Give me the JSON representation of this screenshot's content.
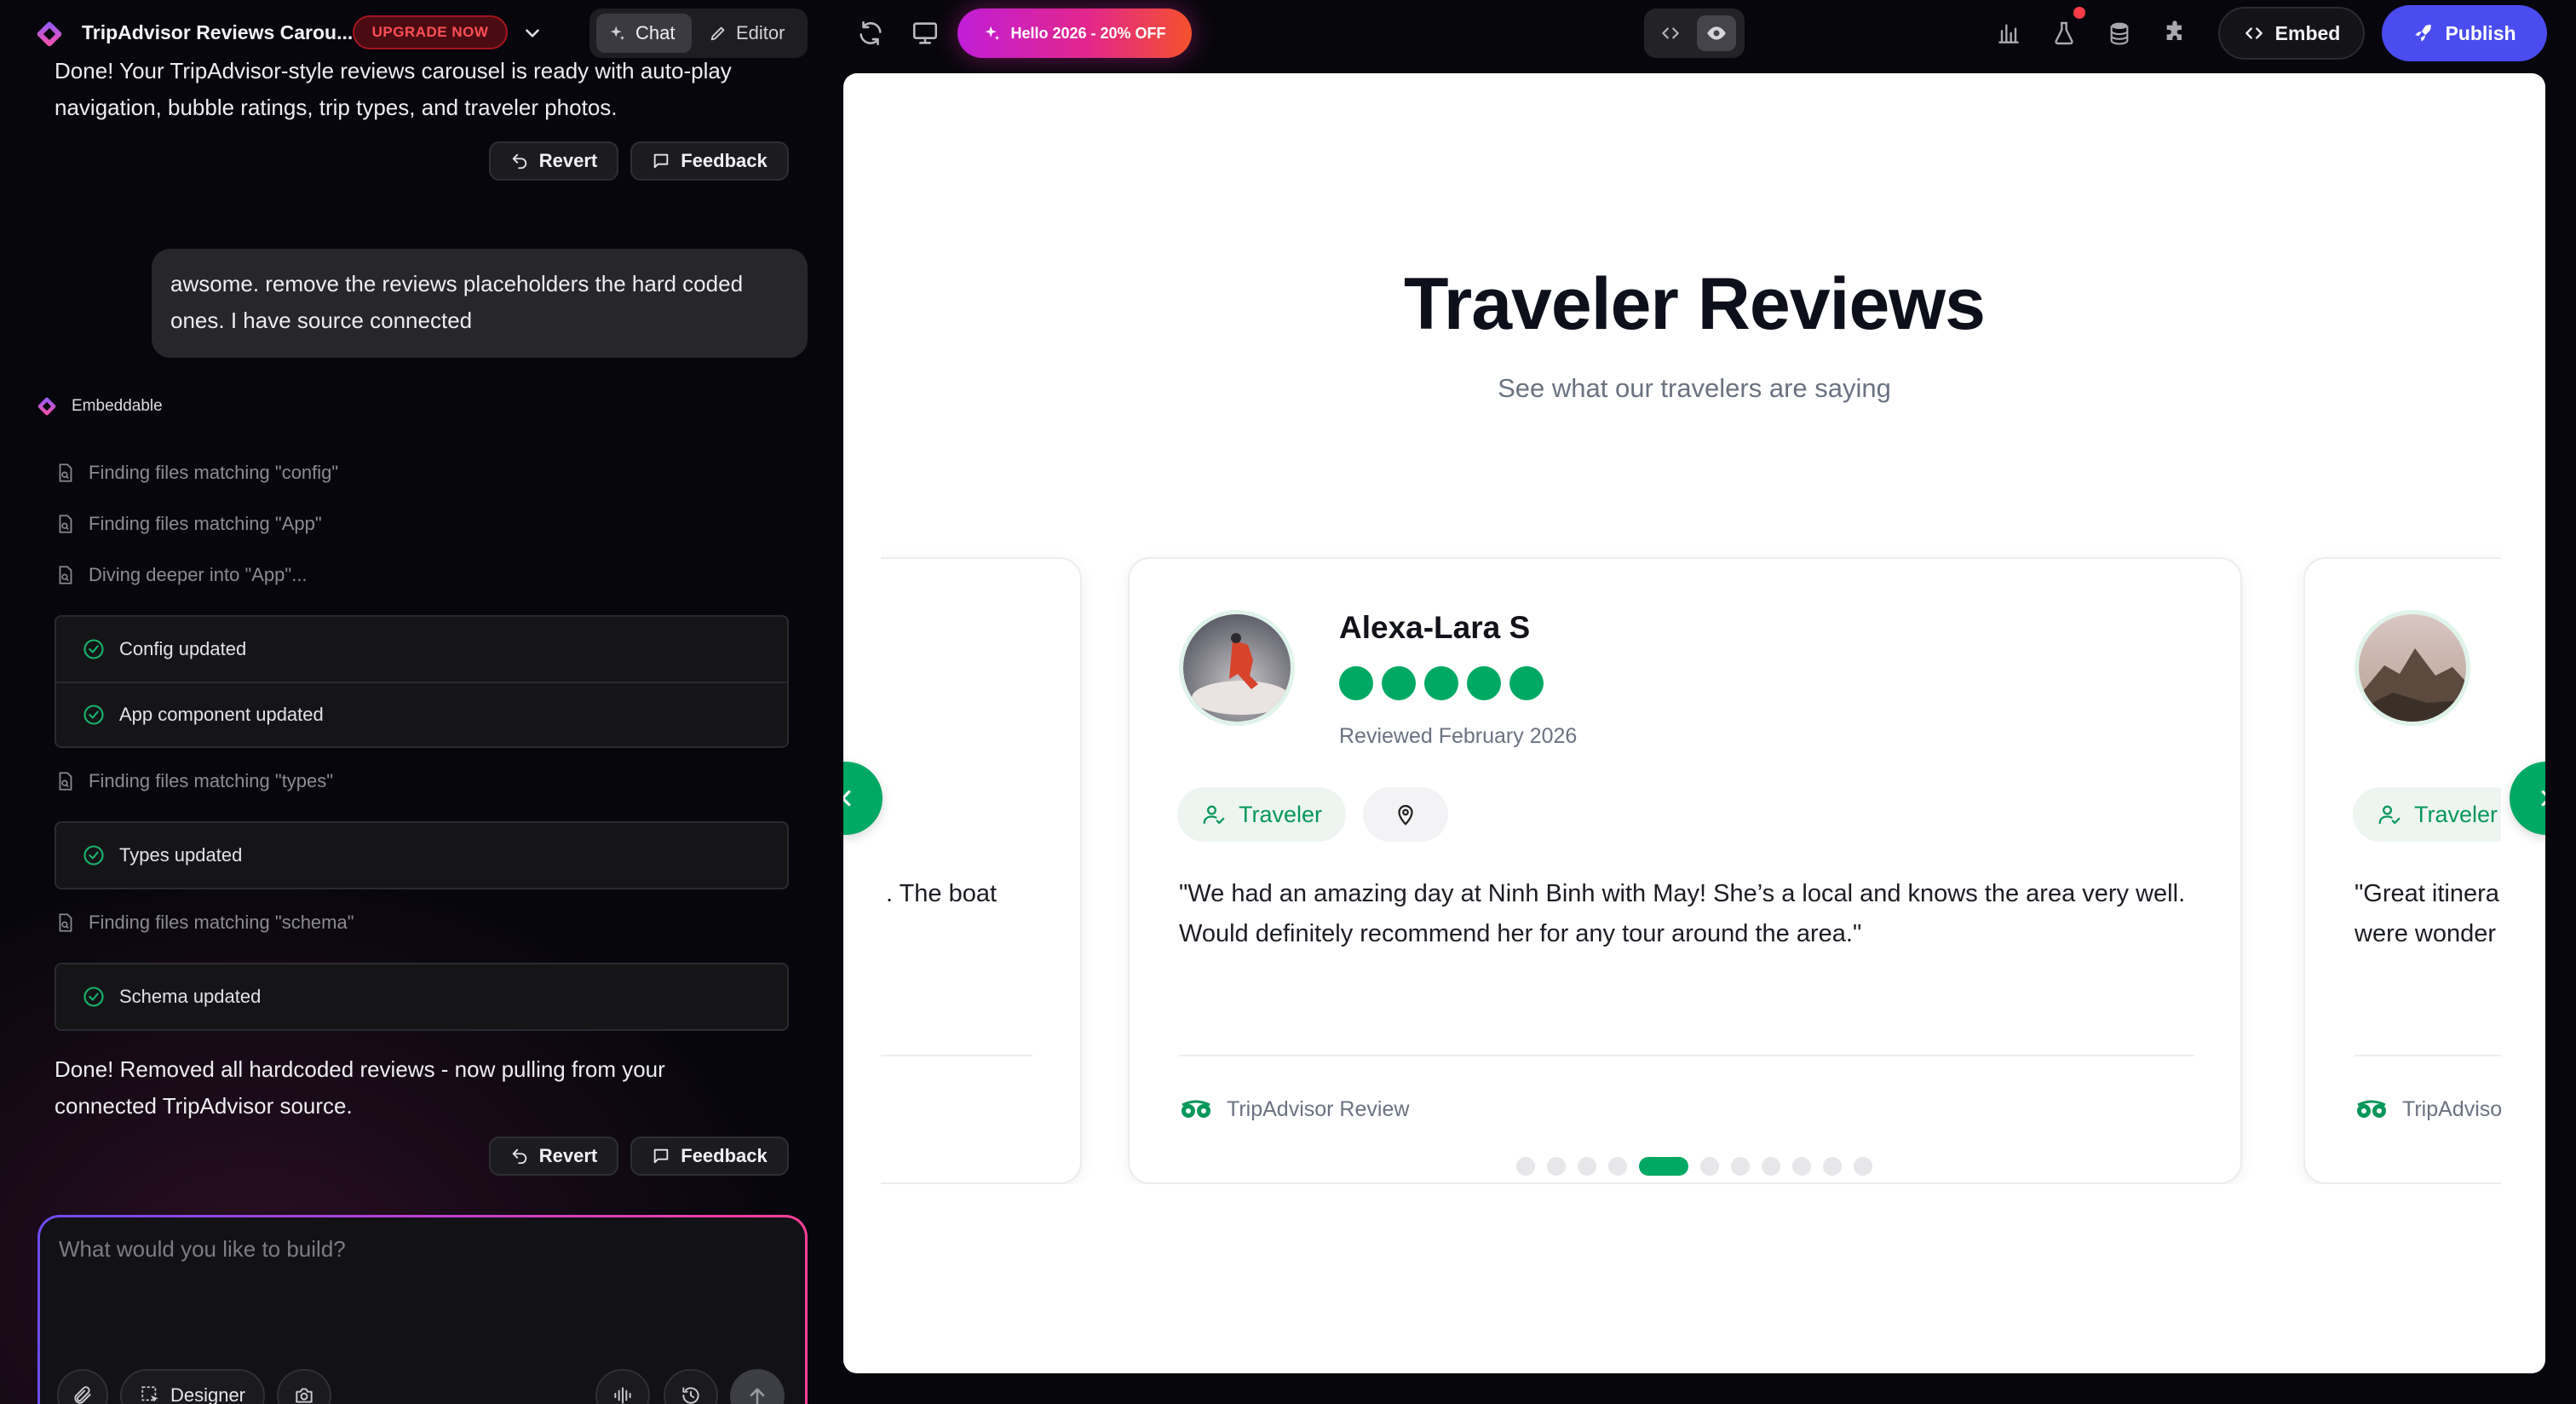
{
  "topbar": {
    "project_title": "TripAdvisor Reviews Carou...",
    "upgrade_label": "UPGRADE NOW",
    "mode_chat": "Chat",
    "mode_editor": "Editor",
    "promo_label": "Hello 2026 - 20% OFF",
    "embed_label": "Embed",
    "publish_label": "Publish"
  },
  "chat": {
    "msg1_line1": "Done! Your TripAdvisor-style reviews carousel is ready with auto-play",
    "msg1_line2": "navigation, bubble ratings, trip types, and traveler photos.",
    "revert_label": "Revert",
    "feedback_label": "Feedback",
    "user_message": "awsome. remove the reviews placeholders the hard coded ones. I have source connected",
    "agent_name": "Embeddable",
    "steps": [
      "Finding files matching \"config\"",
      "Finding files matching \"App\"",
      "Diving deeper into \"App\"...",
      "Finding files matching \"types\"",
      "Finding files matching \"schema\""
    ],
    "done_items": [
      "Config updated",
      "App component updated",
      "Types updated",
      "Schema updated"
    ],
    "msg2_line1": "Done! Removed all hardcoded reviews - now pulling from your",
    "msg2_line2": "connected TripAdvisor source.",
    "composer_placeholder": "What would you like to build?",
    "designer_label": "Designer"
  },
  "preview": {
    "title": "Traveler Reviews",
    "subtitle": "See what our travelers are saying",
    "left_card_fragment": ". The boat",
    "main_card": {
      "name": "Alexa-Lara S",
      "rating": 5,
      "reviewed": "Reviewed February 2026",
      "trip_type": "Traveler",
      "text_line1": "\"We had an amazing day at Ninh Binh with May! She’s a local and knows the area very well.",
      "text_line2": "Would definitely recommend her for any tour around the area.\"",
      "source": "TripAdvisor Review"
    },
    "right_card": {
      "trip_type": "Traveler",
      "text_line1": "\"Great itinera",
      "text_line2": "were wonder",
      "source": "TripAdvisor Review"
    },
    "dots_total": 11,
    "dots_active": 4
  },
  "colors": {
    "accent_green": "#00a963",
    "publish_blue": "#4a4cf0",
    "upgrade_red": "#ff4e55"
  }
}
